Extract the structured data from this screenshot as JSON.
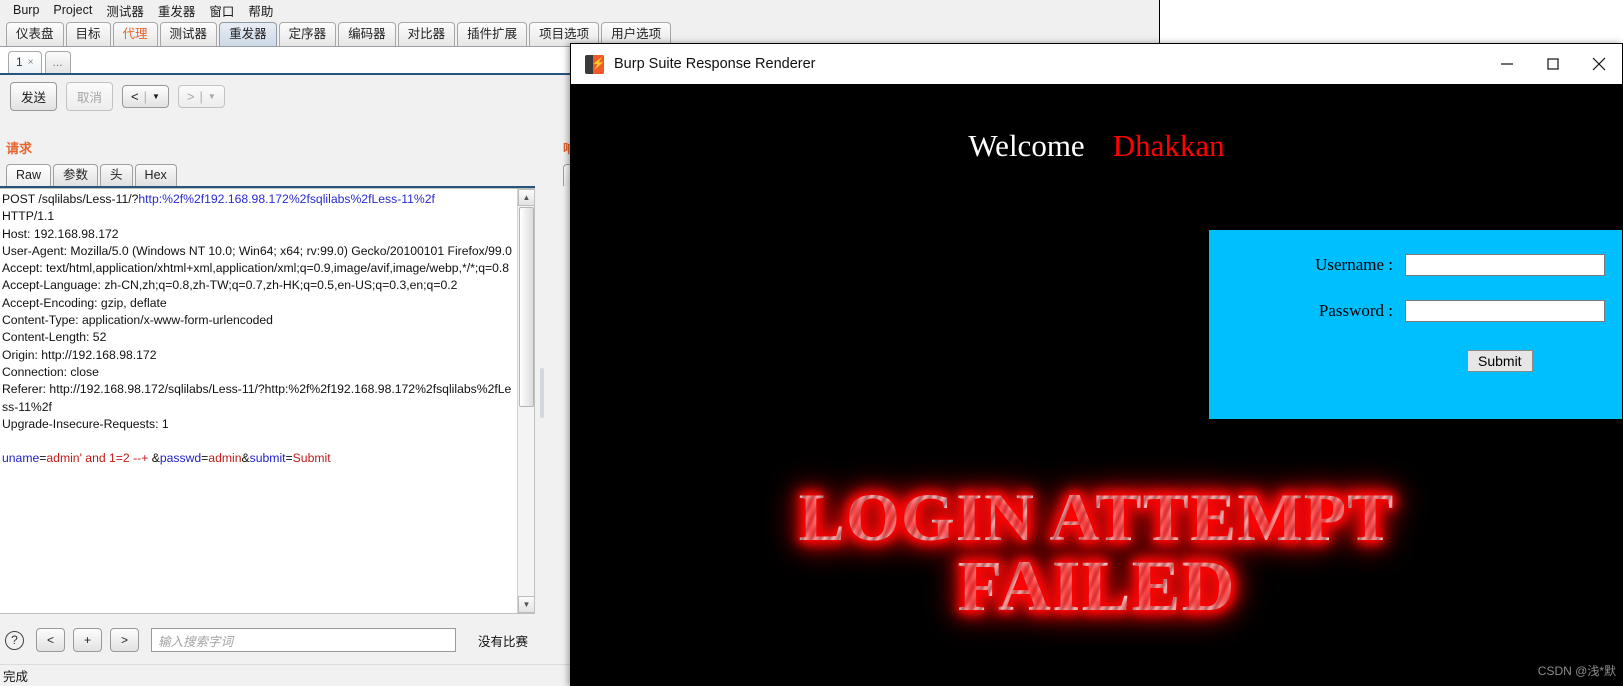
{
  "burp": {
    "menu": [
      "Burp",
      "Project",
      "测试器",
      "重发器",
      "窗口",
      "帮助"
    ],
    "main_tabs": [
      {
        "label": "仪表盘",
        "state": "normal"
      },
      {
        "label": "目标",
        "state": "normal"
      },
      {
        "label": "代理",
        "state": "accent"
      },
      {
        "label": "测试器",
        "state": "normal"
      },
      {
        "label": "重发器",
        "state": "selected"
      },
      {
        "label": "定序器",
        "state": "normal"
      },
      {
        "label": "编码器",
        "state": "normal"
      },
      {
        "label": "对比器",
        "state": "normal"
      },
      {
        "label": "插件扩展",
        "state": "normal"
      },
      {
        "label": "项目选项",
        "state": "normal"
      },
      {
        "label": "用户选项",
        "state": "normal"
      }
    ],
    "repeater_tabs": [
      {
        "label": "1",
        "close": "×",
        "active": true
      },
      {
        "label": "...",
        "close": "",
        "active": false
      }
    ],
    "toolbar": {
      "send": "发送",
      "cancel": "取消",
      "back": "<",
      "forward": ">",
      "caret": "▼",
      "separator": "|"
    },
    "request_label": "请求",
    "response_label": "响应",
    "request_tabs": [
      {
        "label": "Raw",
        "selected": true
      },
      {
        "label": "参数",
        "selected": false
      },
      {
        "label": "头",
        "selected": false
      },
      {
        "label": "Hex",
        "selected": false
      }
    ],
    "request_text": {
      "line1_prefix": "POST /sqlilabs/Less-11/?",
      "line1_url": "http:%2f%2f192.168.98.172%2fsqlilabs%2fLess-11%2f",
      "line2": "HTTP/1.1",
      "headers": [
        "Host: 192.168.98.172",
        "User-Agent: Mozilla/5.0 (Windows NT 10.0; Win64; x64; rv:99.0) Gecko/20100101 Firefox/99.0",
        "Accept: text/html,application/xhtml+xml,application/xml;q=0.9,image/avif,image/webp,*/*;q=0.8",
        "Accept-Language: zh-CN,zh;q=0.8,zh-TW;q=0.7,zh-HK;q=0.5,en-US;q=0.3,en;q=0.2",
        "Accept-Encoding: gzip, deflate",
        "Content-Type: application/x-www-form-urlencoded",
        "Content-Length: 52",
        "Origin: http://192.168.98.172",
        "Connection: close",
        "Referer: http://192.168.98.172/sqlilabs/Less-11/?http:%2f%2f192.168.98.172%2fsqlilabs%2fLess-11%2f",
        "Upgrade-Insecure-Requests: 1"
      ],
      "body_tokens": [
        {
          "text": "uname",
          "kind": "key"
        },
        {
          "text": "=",
          "kind": "plain"
        },
        {
          "text": "admin' and 1=2 --+ ",
          "kind": "val"
        },
        {
          "text": "&",
          "kind": "plain"
        },
        {
          "text": "passwd",
          "kind": "key"
        },
        {
          "text": "=",
          "kind": "plain"
        },
        {
          "text": "admin",
          "kind": "val"
        },
        {
          "text": "&",
          "kind": "plain"
        },
        {
          "text": "submit",
          "kind": "key"
        },
        {
          "text": "=",
          "kind": "plain"
        },
        {
          "text": "Submit",
          "kind": "val"
        }
      ]
    },
    "bottom": {
      "help": "?",
      "prev": "<",
      "add": "+",
      "next": ">",
      "search_placeholder": "输入搜索字词",
      "search_value": "",
      "match_status": "没有比赛"
    },
    "status": "完成"
  },
  "renderer": {
    "title": "Burp Suite Response Renderer",
    "icon": "burp-logo-icon",
    "window_controls": {
      "minimize": "minimize-icon",
      "maximize": "maximize-icon",
      "close": "close-icon"
    },
    "page": {
      "welcome_text": "Welcome",
      "user_name": "Dhakkan",
      "form": {
        "username_label": "Username :",
        "username_value": "",
        "password_label": "Password :",
        "password_value": "",
        "submit_label": "Submit",
        "panel_color": "#00bfff"
      },
      "result_line1": "LOGIN ATTEMPT",
      "result_line2": "FAILED",
      "result_color": "#ff0000"
    },
    "watermark": "CSDN @浅*默"
  }
}
